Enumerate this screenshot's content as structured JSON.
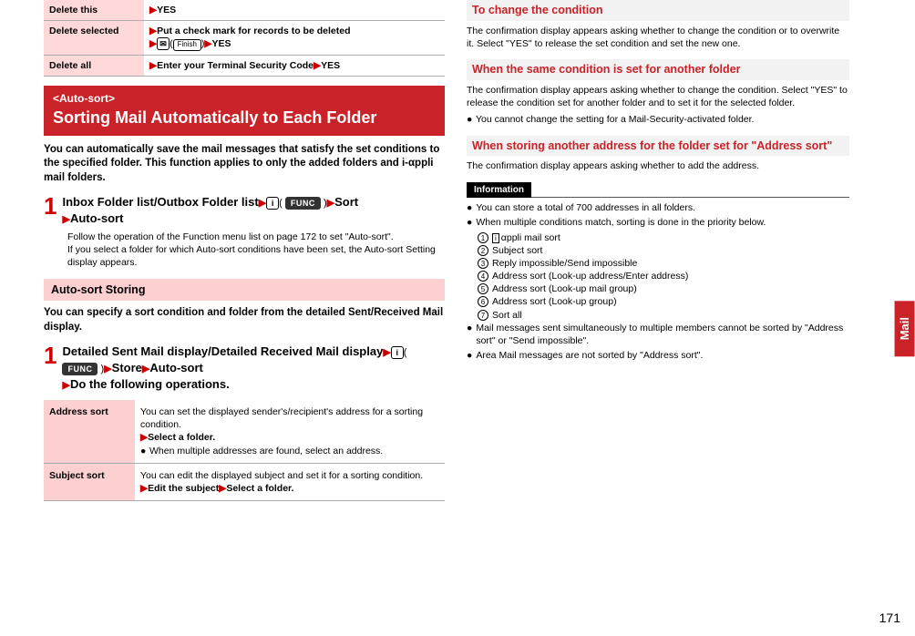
{
  "side_tab": "Mail",
  "page_number": "171",
  "top_table": {
    "rows": [
      {
        "label": "Delete this",
        "value": "YES"
      },
      {
        "label": "Delete selected",
        "value_prefix": "Put a check mark for records to be deleted",
        "value_suffix": "YES",
        "has_finish": true
      },
      {
        "label": "Delete all",
        "value_prefix": "Enter your Terminal Security Code",
        "value_suffix": "YES"
      }
    ]
  },
  "red_bar": {
    "pre": "<Auto-sort>",
    "big": "Sorting Mail Automatically to Each Folder"
  },
  "intro": "You can automatically save the mail messages that satisfy the set conditions to the specified folder. This function applies to only the added folders and i-αppli mail folders.",
  "step1": {
    "line": "Inbox Folder list/Outbox Folder list",
    "tail1": "Sort",
    "tail2": "Auto-sort",
    "body": "Follow the operation of the Function menu list on page 172 to set \"Auto-sort\".\nIf you select a folder for which Auto-sort conditions have been set, the Auto-sort Setting display appears."
  },
  "pink_sub": "Auto-sort Storing",
  "sub_intro": "You can specify a sort condition and folder from the detailed Sent/Received Mail display.",
  "step1b": {
    "line1": "Detailed Sent Mail display/Detailed Received Mail display",
    "mid1": "Store",
    "mid2": "Auto-sort",
    "line3": "Do the following operations."
  },
  "ops_table": {
    "rows": [
      {
        "label": "Address sort",
        "text": "You can set the displayed sender's/recipient's address for a sorting condition.",
        "action": "Select a folder.",
        "note": "When multiple addresses are found, select an address."
      },
      {
        "label": "Subject sort",
        "text": "You can edit the displayed subject and set it for a sorting condition.",
        "action_prefix": "Edit the subject",
        "action_suffix": "Select a folder."
      }
    ]
  },
  "right": {
    "h1": "To change the condition",
    "p1": "The confirmation display appears asking whether to change the condition or to overwrite it. Select \"YES\" to release the set condition and set the new one.",
    "h2": "When the same condition is set for another folder",
    "p2": "The confirmation display appears asking whether to change the condition. Select \"YES\" to release the condition set for another folder and to set it for the selected folder.",
    "b2": "You cannot change the setting for a Mail-Security-activated folder.",
    "h3": "When storing another address for the folder set for \"Address sort\"",
    "p3": "The confirmation display appears asking whether to add the address."
  },
  "info_title": "Information",
  "info_items": {
    "i1": "You can store a total of 700 addresses in all folders.",
    "i2": "When multiple conditions match, sorting is done in the priority below.",
    "sub": [
      "αppli mail sort",
      "Subject sort",
      "Reply impossible/Send impossible",
      "Address sort (Look-up address/Enter address)",
      "Address sort (Look-up mail group)",
      "Address sort (Look-up group)",
      "Sort all"
    ],
    "icon_prefix": "i",
    "i3": "Mail messages sent simultaneously to multiple members cannot be sorted by \"Address sort\" or \"Send impossible\".",
    "i4": "Area Mail messages are not sorted by \"Address sort\"."
  },
  "func_label": "FUNC",
  "finish_label": "Finish"
}
